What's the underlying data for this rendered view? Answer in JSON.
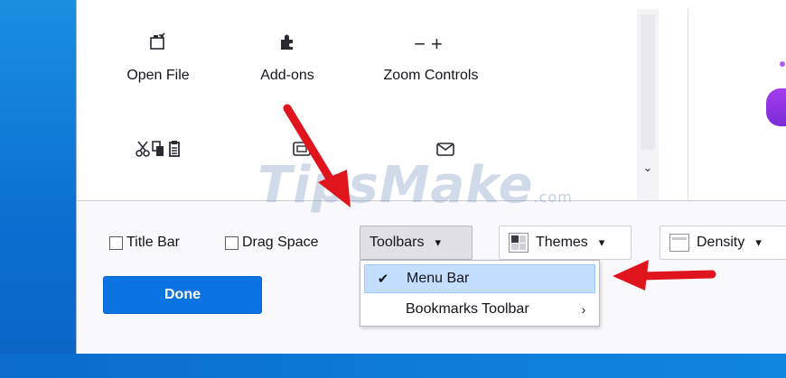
{
  "toolbar_items": [
    {
      "icon": "open-file-icon",
      "label": "Open File"
    },
    {
      "icon": "puzzle-icon",
      "label": "Add-ons"
    },
    {
      "icon": "zoom-icon",
      "glyph": "−+",
      "label": "Zoom Controls"
    },
    {
      "icon": "cut-copy-paste-icon",
      "label": ""
    },
    {
      "icon": "screenshot-icon",
      "label": ""
    },
    {
      "icon": "email-icon",
      "label": ""
    }
  ],
  "bottom": {
    "title_bar": "Title Bar",
    "drag_space": "Drag Space",
    "toolbars": "Toolbars",
    "themes": "Themes",
    "density": "Density",
    "done": "Done"
  },
  "toolbars_menu": {
    "items": [
      {
        "label": "Menu Bar",
        "checked": true
      },
      {
        "label": "Bookmarks Toolbar",
        "submenu": true
      }
    ]
  },
  "watermark": {
    "text": "TipsMake",
    "domain": ".com"
  },
  "colors": {
    "accent": "#0b74e3",
    "arrow": "#e0141c",
    "menu_highlight": "#c3deff",
    "desktop": "#0a6fd0"
  }
}
